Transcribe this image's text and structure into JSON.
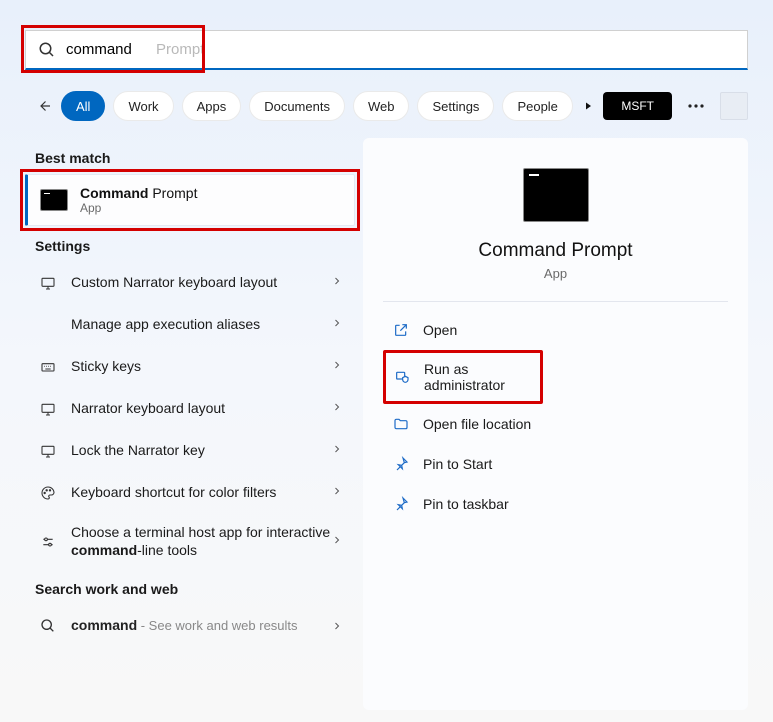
{
  "search": {
    "typed": "command",
    "autocomplete_suffix": " Prompt"
  },
  "filters": {
    "items": [
      "All",
      "Work",
      "Apps",
      "Documents",
      "Web",
      "Settings",
      "People"
    ],
    "active_index": 0,
    "account_label": "MSFT"
  },
  "left": {
    "best_match_header": "Best match",
    "best_match": {
      "title_bold": "Command",
      "title_rest": " Prompt",
      "subtitle": "App"
    },
    "settings_header": "Settings",
    "settings_items": [
      {
        "label": "Custom Narrator keyboard layout",
        "icon": "display"
      },
      {
        "label": "Manage app execution aliases",
        "icon": "none"
      },
      {
        "label": "Sticky keys",
        "icon": "keyboard"
      },
      {
        "label": "Narrator keyboard layout",
        "icon": "display"
      },
      {
        "label": "Lock the Narrator key",
        "icon": "display"
      },
      {
        "label": "Keyboard shortcut for color filters",
        "icon": "palette"
      },
      {
        "label_pre": "Choose a terminal host app for interactive ",
        "label_bold": "command",
        "label_post": "-line tools",
        "icon": "sliders"
      }
    ],
    "web_header": "Search work and web",
    "web_item": {
      "query_bold": "command",
      "suffix": " - See work and web results"
    }
  },
  "detail": {
    "title": "Command Prompt",
    "subtitle": "App",
    "actions": [
      {
        "label": "Open",
        "icon": "open"
      },
      {
        "label": "Run as administrator",
        "icon": "admin",
        "highlight": true
      },
      {
        "label": "Open file location",
        "icon": "folder"
      },
      {
        "label": "Pin to Start",
        "icon": "pin"
      },
      {
        "label": "Pin to taskbar",
        "icon": "pin"
      }
    ]
  }
}
